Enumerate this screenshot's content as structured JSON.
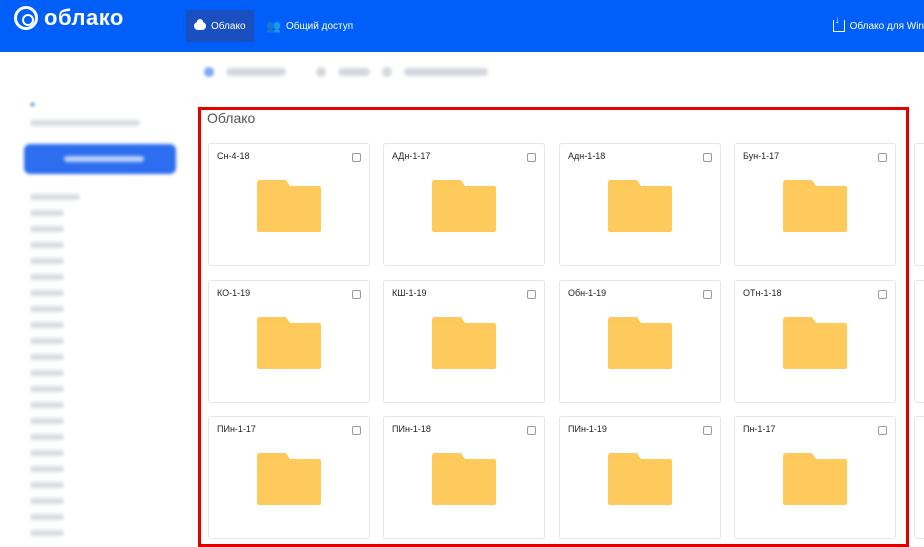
{
  "header": {
    "logo_text": "облако",
    "tabs": [
      {
        "label": "Облако",
        "icon": "cloud-icon",
        "active": true
      },
      {
        "label": "Общий доступ",
        "icon": "users-icon",
        "active": false
      }
    ],
    "download_link": "Облако для Win",
    "colors": {
      "bar": "#005ff9",
      "active_tab": "#1a4fc0"
    }
  },
  "main": {
    "title": "Облако",
    "folders": [
      {
        "name": "Сн-4-18"
      },
      {
        "name": "АДн-1-17"
      },
      {
        "name": "Адн-1-18"
      },
      {
        "name": "Бун-1-17"
      },
      {
        "name": "КО-1-19"
      },
      {
        "name": "КШ-1-19"
      },
      {
        "name": "Обн-1-19"
      },
      {
        "name": "ОТн-1-18"
      },
      {
        "name": "ПИн-1-17"
      },
      {
        "name": "ПИн-1-18"
      },
      {
        "name": "ПИн-1-19"
      },
      {
        "name": "Пн-1-17"
      }
    ],
    "folder_color": "#ffc85a",
    "highlight_color": "#e00000"
  }
}
